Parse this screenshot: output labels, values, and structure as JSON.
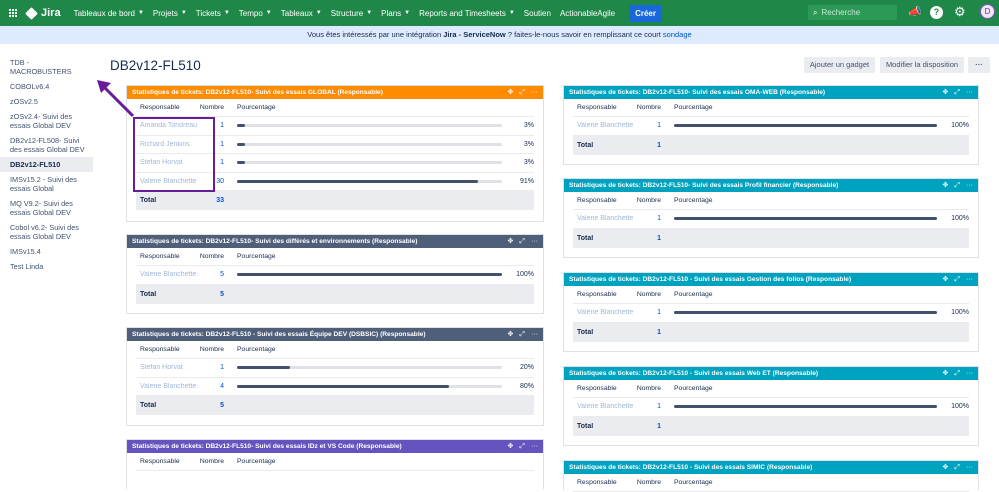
{
  "topbar": {
    "logo": "Jira",
    "nav": [
      "Tableaux de bord",
      "Projets",
      "Tickets",
      "Tempo",
      "Tableaux",
      "Structure",
      "Plans",
      "Reports and Timesheets",
      "Soutien",
      "ActionableAgile"
    ],
    "create": "Créer",
    "search_placeholder": "Recherche",
    "avatar": "D",
    "color": "#1f8748"
  },
  "banner": {
    "text_before": "Vous êtes intéressés par une intégration ",
    "product": "Jira - ServiceNow",
    "text_after": " ? faites-le-nous savoir en remplissant ce court ",
    "link": "sondage"
  },
  "sidebar": {
    "items": [
      "TDB - MACROBUSTERS",
      "COBOLv6.4",
      "zOSv2.5",
      "zOSv2.4- Suivi des essais Global DEV",
      "DB2v12-FL508- Suivi des essais Global DEV",
      "DB2v12-FL510",
      "IMSv15.2 - Suivi des essais Global",
      "MQ V9.2- Suivi des essais Global DEV",
      "Cobol v6.2- Suivi des essais Global DEV",
      "IMSv15.4",
      "Test Linda"
    ],
    "active_index": 5
  },
  "page": {
    "title": "DB2v12-FL510",
    "add_gadget": "Ajouter un gadget",
    "modify_layout": "Modifier la disposition",
    "more": "···"
  },
  "table_labels": {
    "col_assignee": "Responsable",
    "col_count": "Nombre",
    "col_percent": "Pourcentage",
    "total": "Total"
  },
  "gadgets": [
    {
      "title": "Statistiques de tickets: DB2v12-FL510- Suivi des essais GLOBAL (Responsable)",
      "color": "#ff8b00",
      "rows": [
        {
          "name": "Amanda Tondreau",
          "count": "1",
          "percent": "3%",
          "fraction": 0.03
        },
        {
          "name": "Richard Jenkins",
          "count": "1",
          "percent": "3%",
          "fraction": 0.03
        },
        {
          "name": "Stefan Horvat",
          "count": "1",
          "percent": "3%",
          "fraction": 0.03
        },
        {
          "name": "Valerie Blanchette",
          "count": "30",
          "percent": "91%",
          "fraction": 0.91
        }
      ],
      "total": "33"
    },
    {
      "title": "Statistiques de tickets: DB2v12-FL510- Suivi des différés et environnements (Responsable)",
      "color": "#505f79",
      "rows": [
        {
          "name": "Valerie Blanchette",
          "count": "5",
          "percent": "100%",
          "fraction": 1
        }
      ],
      "total": "5"
    },
    {
      "title": "Statistiques de tickets: DB2v12-FL510 - Suivi des essais Équipe DEV (DSBSIC) (Responsable)",
      "color": "#505f79",
      "rows": [
        {
          "name": "Stefan Horvat",
          "count": "1",
          "percent": "20%",
          "fraction": 0.2
        },
        {
          "name": "Valerie Blanchette",
          "count": "4",
          "percent": "80%",
          "fraction": 0.8
        }
      ],
      "total": "5"
    },
    {
      "title": "Statistiques de tickets: DB2v12-FL510- Suivi des essais IDz et VS Code (Responsable)",
      "color": "#6554c0",
      "rows": [],
      "total": ""
    },
    {
      "title": "Statistiques de tickets: DB2v12-FL510- Suivi des essais OMA-WEB (Responsable)",
      "color": "#00a3bf",
      "rows": [
        {
          "name": "Valerie Blanchette",
          "count": "1",
          "percent": "100%",
          "fraction": 1
        }
      ],
      "total": "1"
    },
    {
      "title": "Statistiques de tickets: DB2v12-FL510- Suivi des essais Profil financier (Responsable)",
      "color": "#00a3bf",
      "rows": [
        {
          "name": "Valerie Blanchette",
          "count": "1",
          "percent": "100%",
          "fraction": 1
        }
      ],
      "total": "1"
    },
    {
      "title": "Statistiques de tickets: DB2v12-FL510 - Suivi des essais Gestion des folios (Responsable)",
      "color": "#00a3bf",
      "rows": [
        {
          "name": "Valerie Blanchette",
          "count": "1",
          "percent": "100%",
          "fraction": 1
        }
      ],
      "total": "1"
    },
    {
      "title": "Statistiques de tickets: DB2v12-FL510 - Suivi des essais Web ET (Responsable)",
      "color": "#00a3bf",
      "rows": [
        {
          "name": "Valerie Blanchette",
          "count": "1",
          "percent": "100%",
          "fraction": 1
        }
      ],
      "total": "1"
    },
    {
      "title": "Statistiques de tickets: DB2v12-FL510 - Suivi des essais SIMIC (Responsable)",
      "color": "#00a3bf",
      "rows": [],
      "total": ""
    }
  ]
}
